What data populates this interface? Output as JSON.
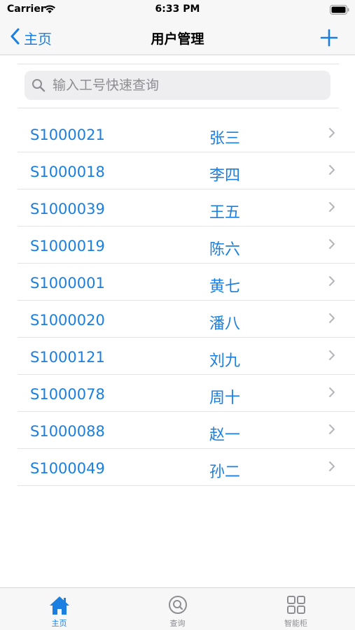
{
  "status_bar": {
    "carrier": "Carrier",
    "time": "6:33 PM"
  },
  "nav": {
    "back_label": "主页",
    "title": "用户管理",
    "add_icon": "plus-icon"
  },
  "search": {
    "placeholder": "输入工号快速查询",
    "value": ""
  },
  "users": [
    {
      "id": "S1000021",
      "name": "张三"
    },
    {
      "id": "S1000018",
      "name": "李四"
    },
    {
      "id": "S1000039",
      "name": "王五"
    },
    {
      "id": "S1000019",
      "name": "陈六"
    },
    {
      "id": "S1000001",
      "name": "黄七"
    },
    {
      "id": "S1000020",
      "name": "潘八"
    },
    {
      "id": "S1000121",
      "name": "刘九"
    },
    {
      "id": "S1000078",
      "name": "周十"
    },
    {
      "id": "S1000088",
      "name": "赵一"
    },
    {
      "id": "S1000049",
      "name": "孙二"
    }
  ],
  "tabs": [
    {
      "label": "主页",
      "icon": "home-icon",
      "active": true
    },
    {
      "label": "查询",
      "icon": "search-icon",
      "active": false
    },
    {
      "label": "智能柜",
      "icon": "grid-icon",
      "active": false
    }
  ],
  "colors": {
    "accent": "#1a7fe0",
    "inactive": "#8e8e93"
  }
}
